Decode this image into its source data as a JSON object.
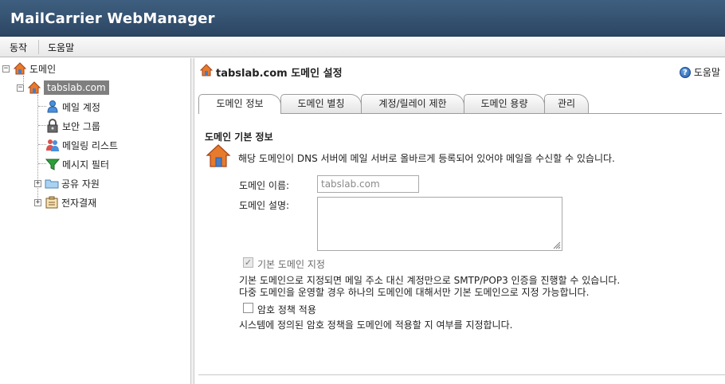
{
  "app": {
    "title": "MailCarrier WebManager"
  },
  "menubar": {
    "items": [
      {
        "label": "동작"
      },
      {
        "label": "도움말"
      }
    ]
  },
  "sidebar": {
    "root": {
      "label": "도메인",
      "toggle": "−"
    },
    "domain": {
      "label": "tabslab.com",
      "toggle": "−"
    },
    "children": [
      {
        "label": "메일 계정",
        "icon": "user-icon"
      },
      {
        "label": "보안 그룹",
        "icon": "lock-group-icon"
      },
      {
        "label": "메일링 리스트",
        "icon": "mailing-list-icon"
      },
      {
        "label": "메시지 필터",
        "icon": "filter-funnel-icon"
      }
    ],
    "extra": [
      {
        "label": "공유 자원",
        "icon": "folder-icon",
        "toggle": "+"
      },
      {
        "label": "전자결재",
        "icon": "approval-icon",
        "toggle": "+"
      }
    ]
  },
  "main": {
    "title": "tabslab.com 도메인 설정",
    "help_label": "도움말",
    "tabs": [
      {
        "label": "도메인 정보",
        "active": true
      },
      {
        "label": "도메인 별칭",
        "active": false
      },
      {
        "label": "계정/릴레이 제한",
        "active": false
      },
      {
        "label": "도메인 용량",
        "active": false
      },
      {
        "label": "관리",
        "active": false
      }
    ],
    "section_title": "도메인 기본 정보",
    "info_text": "해당 도메인이 DNS 서버에 메일 서버로 올바르게 등록되어 있어야 메일을 수신할 수 있습니다.",
    "domain_name_label": "도메인 이름:",
    "domain_name_value": "tabslab.com",
    "domain_desc_label": "도메인 설명:",
    "domain_desc_value": "",
    "default_domain_label": "기본 도메인 지정",
    "default_domain_checked": true,
    "default_domain_desc_1": "기본 도메인으로 지정되면 메일 주소 대신 계정만으로 SMTP/POP3 인증을 진행할 수 있습니다.",
    "default_domain_desc_2": "다중 도메인을 운영할 경우 하나의 도메인에 대해서만 기본 도메인으로 지정 가능합니다.",
    "password_policy_label": "암호 정책 적용",
    "password_policy_checked": false,
    "password_policy_desc": "시스템에 정의된 암호 정책을 도메인에 적용할 지 여부를 지정합니다."
  },
  "colors": {
    "header_bg": "#2c4663",
    "selected_node_bg": "#7f7f7f",
    "help_icon": "#1e5aa8"
  }
}
